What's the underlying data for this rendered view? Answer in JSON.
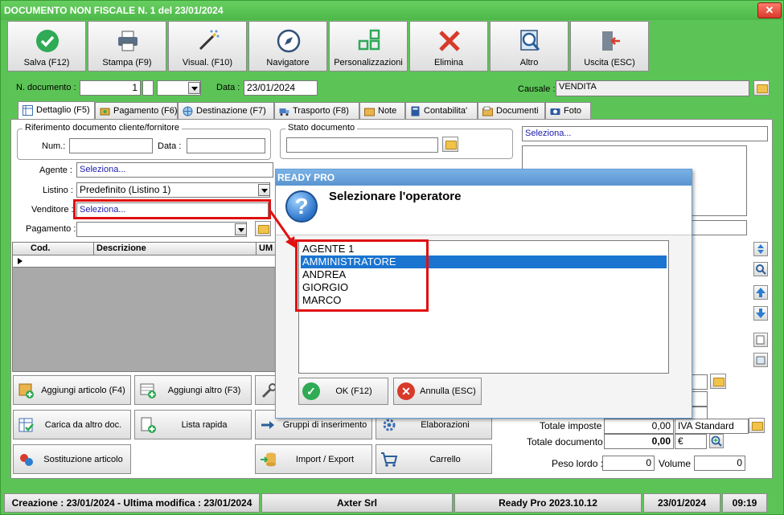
{
  "window": {
    "title": "DOCUMENTO NON FISCALE N. 1 del 23/01/2024",
    "close_label": "✕"
  },
  "toolbar": [
    {
      "label": "Salva (F12)",
      "icon": "check-circle-icon"
    },
    {
      "label": "Stampa (F9)",
      "icon": "printer-icon"
    },
    {
      "label": "Visual. (F10)",
      "icon": "magic-wand-icon"
    },
    {
      "label": "Navigatore",
      "icon": "compass-icon"
    },
    {
      "label": "Personalizzazioni",
      "icon": "grid-icon"
    },
    {
      "label": "Elimina",
      "icon": "red-x-icon"
    },
    {
      "label": "Altro",
      "icon": "magnifier-icon"
    },
    {
      "label": "Uscita (ESC)",
      "icon": "exit-door-icon"
    }
  ],
  "header": {
    "ndoc_label": "N. documento :",
    "ndoc_value": "1",
    "data_label": "Data :",
    "data_value": "23/01/2024",
    "causale_label": "Causale :",
    "causale_value": "VENDITA"
  },
  "tabs": [
    "Dettaglio (F5)",
    "Pagamento (F6)",
    "Destinazione (F7)",
    "Trasporto (F8)",
    "Note",
    "Contabilita'",
    "Documenti",
    "Foto"
  ],
  "rif": {
    "title": "Riferimento documento cliente/fornitore",
    "num_label": "Num.:",
    "data_label": "Data :"
  },
  "stato": {
    "title": "Stato documento"
  },
  "right_select": "Seleziona...",
  "fields": {
    "agente_label": "Agente :",
    "agente_value": "Seleziona...",
    "listino_label": "Listino :",
    "listino_value": "Predefinito (Listino 1)",
    "venditore_label": "Venditore :",
    "venditore_value": "Seleziona...",
    "pagamento_label": "Pagamento :"
  },
  "grid": {
    "columns": [
      "Cod.",
      "Descrizione",
      "UM"
    ]
  },
  "buttons": [
    {
      "label": "Aggiungi articolo (F4)"
    },
    {
      "label": "Aggiungi altro (F3)"
    },
    {
      "label": "Carica da altro doc."
    },
    {
      "label": "Lista rapida"
    },
    {
      "label": "Gruppi di inserimento"
    },
    {
      "label": "Elaborazioni"
    },
    {
      "label": "Sostituzione articolo"
    },
    {
      "label": "Import / Export"
    },
    {
      "label": "Carrello"
    }
  ],
  "totals": {
    "imposte_label": "Totale imposte :",
    "imposte_value": "0,00",
    "iva_label": "IVA Standard",
    "documento_label": "Totale documento :",
    "documento_value": "0,00",
    "currency": "€",
    "peso_label": "Peso lordo :",
    "peso_value": "0",
    "volume_label": "Volume :",
    "volume_value": "0"
  },
  "status": {
    "creazione": "Creazione : 23/01/2024 - Ultima modifica : 23/01/2024",
    "company": "Axter Srl",
    "version": "Ready Pro 2023.10.12",
    "date": "23/01/2024",
    "time": "09:19"
  },
  "dialog": {
    "title": "READY PRO",
    "message": "Selezionare l'operatore",
    "operators": [
      "AGENTE 1",
      "AMMINISTRATORE",
      "ANDREA",
      "GIORGIO",
      "MARCO"
    ],
    "selected_index": 1,
    "ok_label": "OK (F12)",
    "cancel_label": "Annulla (ESC)"
  },
  "colors": {
    "window_bg": "#5cc456",
    "highlight": "#1a74d0",
    "annotation": "#e01010"
  }
}
